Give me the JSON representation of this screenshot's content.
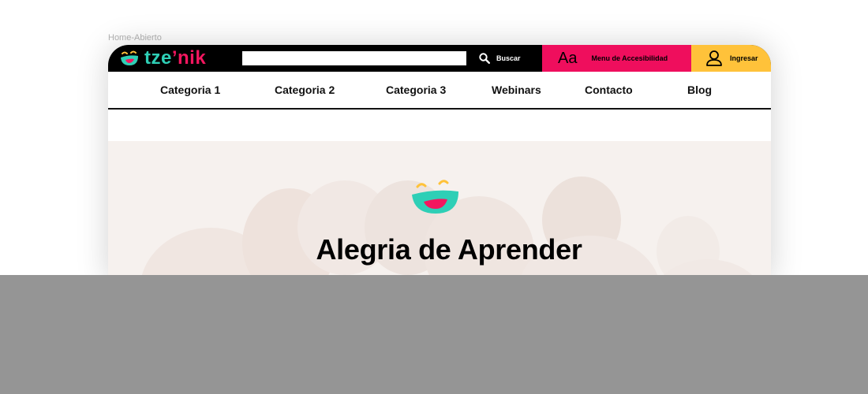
{
  "frame_label": "Home-Abierto",
  "header": {
    "logo": {
      "prefix": "tze",
      "suffix": "’nik"
    },
    "search": {
      "value": "",
      "placeholder": "",
      "button_label": "Buscar"
    },
    "accessibility": {
      "glyph": "Aa",
      "label": "Menu de Accesibilidad"
    },
    "login": {
      "label": "Ingresar"
    }
  },
  "nav": {
    "items": [
      {
        "label": "Categoria 1"
      },
      {
        "label": "Categoria 2"
      },
      {
        "label": "Categoria 3"
      },
      {
        "label": "Webinars"
      },
      {
        "label": "Contacto"
      },
      {
        "label": "Blog"
      }
    ]
  },
  "hero": {
    "title": "Alegria de Aprender",
    "icon": "smiling-face-icon"
  },
  "colors": {
    "topbar": "#000000",
    "accessibility_bg": "#ef0e5d",
    "login_bg": "#ffc23a",
    "brand_teal": "#2ecfb6",
    "brand_pink": "#f4165f",
    "overlay": "#959595"
  }
}
